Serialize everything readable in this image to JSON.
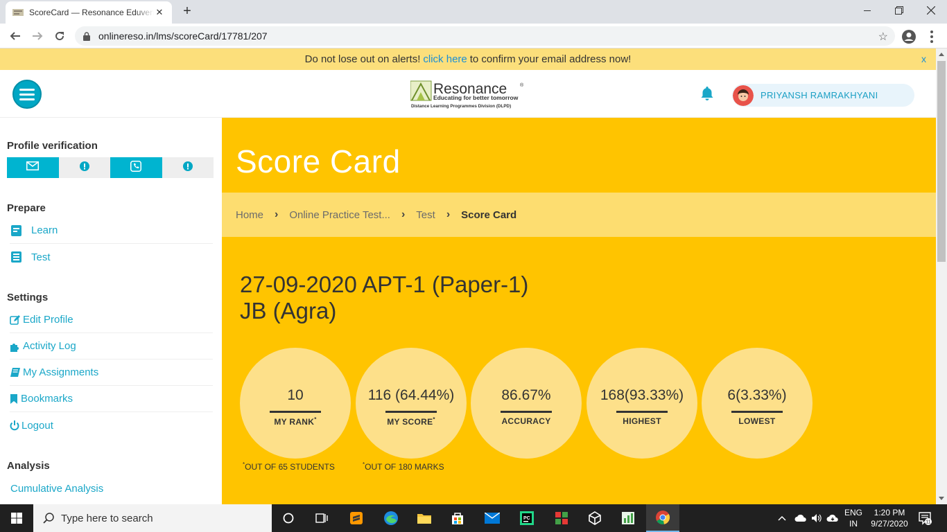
{
  "browser": {
    "tab_title": "ScoreCard — Resonance Eduventures",
    "url": "onlinereso.in/lms/scoreCard/17781/207"
  },
  "alert": {
    "before": "Do not lose out on alerts!",
    "link": "click here",
    "after": "to confirm your email address now!",
    "close": "x"
  },
  "header": {
    "logo_name": "Resonance",
    "logo_tagline": "Educating for better tomorrow",
    "logo_division": "Distance Learning Programmes Division (DLPD)",
    "user_name": "PRIYANSH RAMRAKHYANI"
  },
  "sidebar": {
    "profile_heading": "Profile verification",
    "prepare_heading": "Prepare",
    "prepare_items": [
      {
        "label": "Learn",
        "icon": "book-icon"
      },
      {
        "label": "Test",
        "icon": "list-icon"
      }
    ],
    "settings_heading": "Settings",
    "settings_items": [
      {
        "label": "Edit Profile",
        "icon": "edit-icon"
      },
      {
        "label": "Activity Log",
        "icon": "puzzle-icon"
      },
      {
        "label": "My Assignments",
        "icon": "book-icon"
      },
      {
        "label": "Bookmarks",
        "icon": "bookmark-icon"
      },
      {
        "label": "Logout",
        "icon": "power-icon"
      }
    ],
    "analysis_heading": "Analysis",
    "analysis_items": [
      {
        "label": "Cumulative Analysis"
      }
    ]
  },
  "main": {
    "title": "Score Card",
    "breadcrumb": [
      "Home",
      "Online Practice Test...",
      "Test",
      "Score Card"
    ],
    "test_title_line1": "27-09-2020 APT-1 (Paper-1)",
    "test_title_line2": "JB (Agra)",
    "stats": [
      {
        "value": "10",
        "label": "MY RANK",
        "star": "*"
      },
      {
        "value": "116 (64.44%)",
        "label": "MY SCORE",
        "star": "*"
      },
      {
        "value": "86.67%",
        "label": "ACCURACY",
        "star": ""
      },
      {
        "value": "168(93.33%)",
        "label": "HIGHEST",
        "star": ""
      },
      {
        "value": "6(3.33%)",
        "label": "LOWEST",
        "star": ""
      }
    ],
    "notes": [
      "OUT OF 65 STUDENTS",
      "OUT OF 180 MARKS"
    ],
    "note_mark": "*"
  },
  "taskbar": {
    "search_placeholder": "Type here to search",
    "lang_line1": "ENG",
    "lang_line2": "IN",
    "time": "1:20 PM",
    "date": "9/27/2020",
    "notif_count": "11"
  },
  "colors": {
    "accent": "#00a7c4",
    "main_bg": "#ffc400",
    "crumb_bg": "#fddd70",
    "circle_bg": "#fde08a",
    "alert_bg": "#fcdf7b"
  }
}
